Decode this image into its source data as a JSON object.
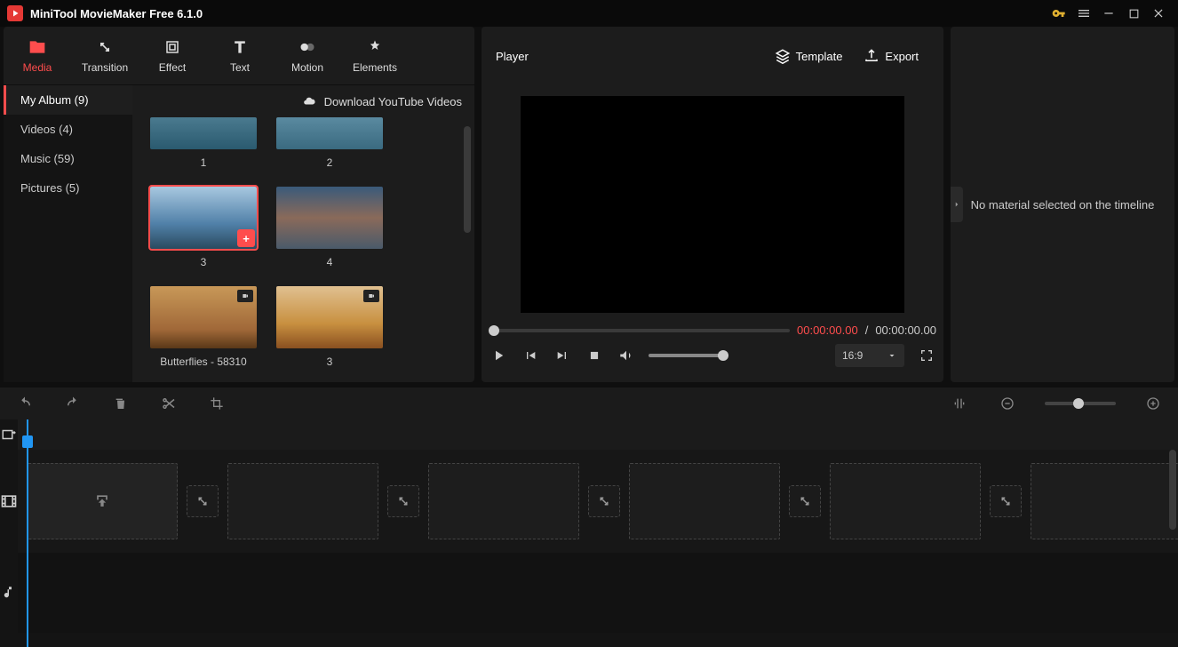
{
  "app": {
    "title": "MiniTool MovieMaker Free 6.1.0"
  },
  "tabs": [
    {
      "label": "Media"
    },
    {
      "label": "Transition"
    },
    {
      "label": "Effect"
    },
    {
      "label": "Text"
    },
    {
      "label": "Motion"
    },
    {
      "label": "Elements"
    }
  ],
  "sidebar": {
    "items": [
      {
        "label": "My Album (9)"
      },
      {
        "label": "Videos (4)"
      },
      {
        "label": "Music (59)"
      },
      {
        "label": "Pictures (5)"
      }
    ]
  },
  "mediaHeader": {
    "download": "Download YouTube Videos"
  },
  "media": {
    "items": [
      {
        "label": "1"
      },
      {
        "label": "2"
      },
      {
        "label": "3"
      },
      {
        "label": "4"
      },
      {
        "label": "Butterflies - 58310"
      },
      {
        "label": "3"
      }
    ]
  },
  "player": {
    "title": "Player",
    "template": "Template",
    "export": "Export",
    "timeCurrent": "00:00:00.00",
    "timeSep": "/",
    "timeTotal": "00:00:00.00",
    "aspect": "16:9"
  },
  "rightPanel": {
    "message": "No material selected on the timeline"
  }
}
